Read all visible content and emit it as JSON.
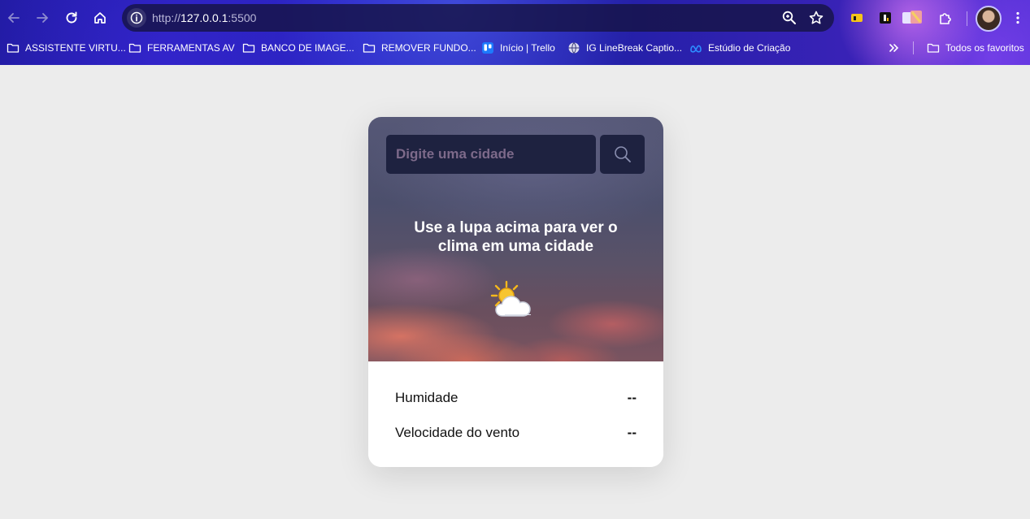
{
  "browser": {
    "url_scheme": "http://",
    "url_host": "127.0.0.1",
    "url_port": ":5500",
    "bookmarks": [
      "ASSISTENTE VIRTU...",
      "FERRAMENTAS AV",
      "BANCO DE IMAGE...",
      "REMOVER FUNDO...",
      "Início | Trello",
      "IG LineBreak Captio...",
      "Estúdio de Criação"
    ],
    "all_bookmarks": "Todos os favoritos",
    "icons": {
      "back": "arrow-left-icon",
      "forward": "arrow-right-icon",
      "reload": "reload-icon",
      "home": "home-icon",
      "zoom": "zoom-icon",
      "star": "star-icon",
      "extensions": "puzzle-icon",
      "menu": "kebab-menu-icon"
    }
  },
  "app": {
    "search": {
      "placeholder": "Digite uma cidade",
      "value": ""
    },
    "hint": "Use a lupa acima para ver o clima em uma cidade",
    "weather_icon": "sun-behind-cloud-icon",
    "stats": {
      "humidity_label": "Humidade",
      "humidity_value": "--",
      "wind_label": "Velocidade do vento",
      "wind_value": "--"
    },
    "colors": {
      "input_bg": "#1e2240",
      "placeholder": "#7d6a8a",
      "page_bg": "#ececec"
    }
  }
}
